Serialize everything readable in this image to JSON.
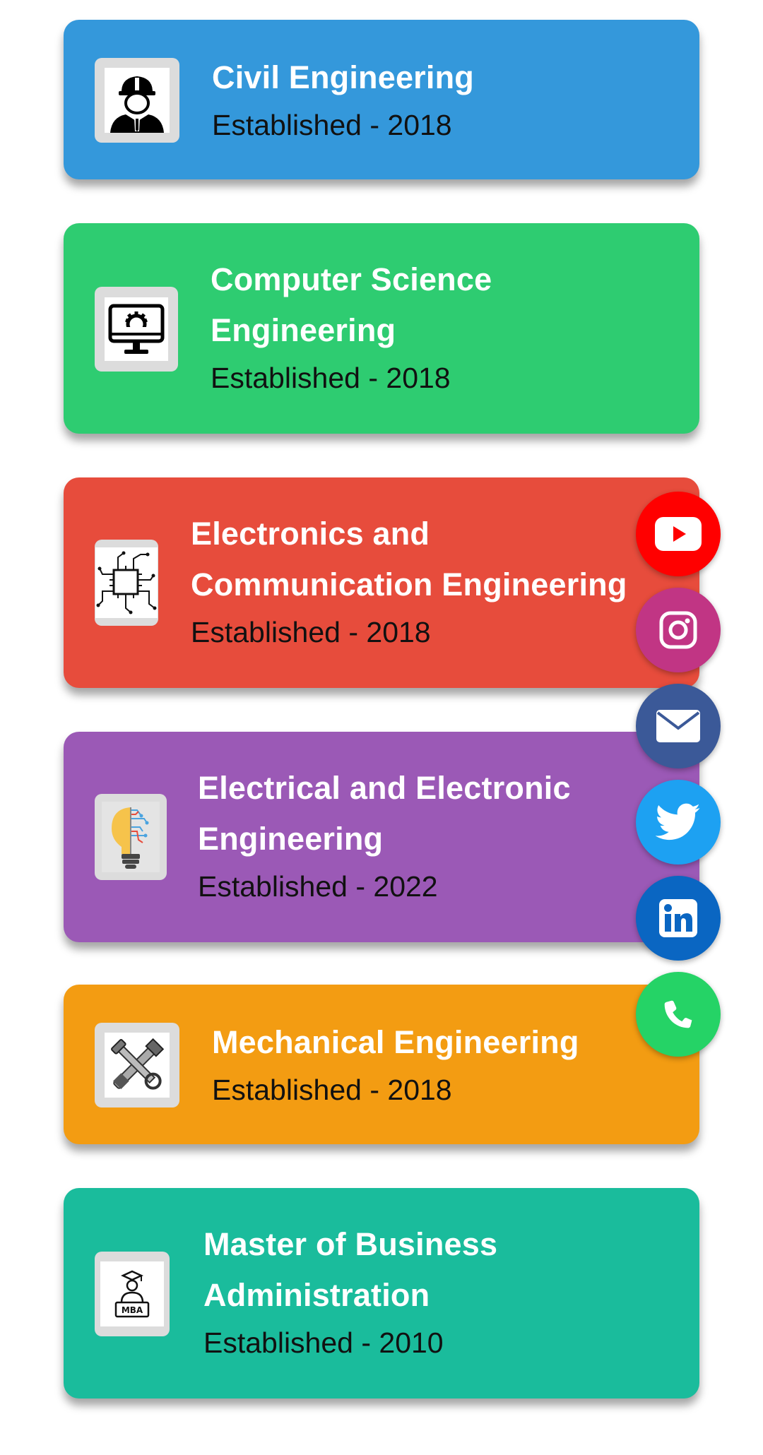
{
  "departments": [
    {
      "name": "Civil Engineering",
      "established": "Established - 2018",
      "color": "#3498db",
      "icon": "engineer-helmet-icon"
    },
    {
      "name": "Computer Science\nEngineering",
      "established": "Established - 2018",
      "color": "#2ecc71",
      "icon": "computer-monitor-gear-icon"
    },
    {
      "name": "Electronics and\nCommunication Engineering",
      "established": "Established - 2018",
      "color": "#e74c3c",
      "icon": "microchip-circuit-icon"
    },
    {
      "name": "Electrical and Electronic\nEngineering",
      "established": "Established - 2022",
      "color": "#9b59b6",
      "icon": "lightbulb-circuit-icon"
    },
    {
      "name": "Mechanical Engineering",
      "established": "Established - 2018",
      "color": "#f39c12",
      "icon": "crossed-tools-icon"
    },
    {
      "name": "Master of Business\nAdministration",
      "established": "Established - 2010",
      "color": "#1abc9c",
      "icon": "mba-graduate-icon",
      "icon_label": "MBA"
    }
  ],
  "social": [
    {
      "name": "youtube",
      "icon": "youtube-icon",
      "color": "#ff0000"
    },
    {
      "name": "instagram",
      "icon": "instagram-icon",
      "color": "#c13584"
    },
    {
      "name": "email",
      "icon": "envelope-icon",
      "color": "#3b5998"
    },
    {
      "name": "twitter",
      "icon": "twitter-bird-icon",
      "color": "#1da1f2"
    },
    {
      "name": "linkedin",
      "icon": "linkedin-icon",
      "color": "#0a66c2"
    },
    {
      "name": "phone",
      "icon": "phone-icon",
      "color": "#25d366"
    }
  ]
}
